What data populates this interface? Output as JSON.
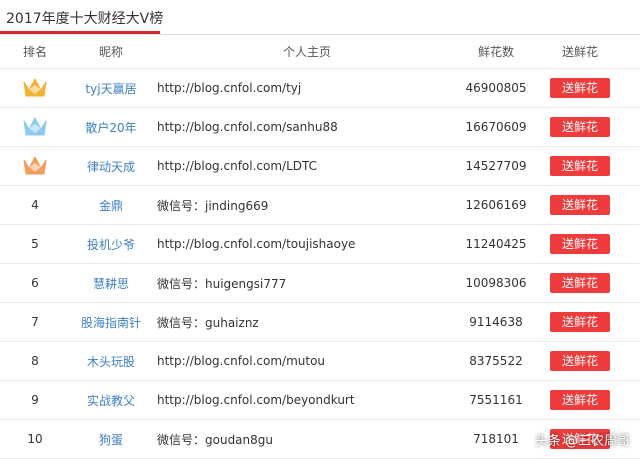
{
  "title": "2017年度十大财经大V榜",
  "colors": {
    "accent_red": "#d6292b",
    "button_red": "#ee3b3b",
    "link_blue": "#3d7fc4",
    "crown_gold": "#f2b233",
    "crown_blue": "#8ec9ee",
    "crown_orange": "#f29d5c"
  },
  "headers": {
    "rank": "排名",
    "nick": "昵称",
    "home": "个人主页",
    "count": "鲜花数",
    "send": "送鲜花"
  },
  "rows": [
    {
      "rank": "",
      "icon": "gold-crown-icon",
      "nick": "tyj天赢居",
      "home": "http://blog.cnfol.com/tyj",
      "count": "46900805",
      "send": "送鲜花"
    },
    {
      "rank": "",
      "icon": "silver-crown-icon",
      "nick": "散户20年",
      "home": "http://blog.cnfol.com/sanhu88",
      "count": "16670609",
      "send": "送鲜花"
    },
    {
      "rank": "",
      "icon": "bronze-crown-icon",
      "nick": "律动天成",
      "home": "http://blog.cnfol.com/LDTC",
      "count": "14527709",
      "send": "送鲜花"
    },
    {
      "rank": "4",
      "icon": "",
      "nick": "金鼎",
      "home": "微信号：jinding669",
      "count": "12606169",
      "send": "送鲜花"
    },
    {
      "rank": "5",
      "icon": "",
      "nick": "投机少爷",
      "home": "http://blog.cnfol.com/toujishaoye",
      "count": "11240425",
      "send": "送鲜花"
    },
    {
      "rank": "6",
      "icon": "",
      "nick": "慧耕思",
      "home": "微信号：huigengsi777",
      "count": "10098306",
      "send": "送鲜花"
    },
    {
      "rank": "7",
      "icon": "",
      "nick": "股海指南针",
      "home": "微信号：guhaiznz",
      "count": "9114638",
      "send": "送鲜花"
    },
    {
      "rank": "8",
      "icon": "",
      "nick": "木头玩股",
      "home": "http://blog.cnfol.com/mutou",
      "count": "8375522",
      "send": "送鲜花"
    },
    {
      "rank": "9",
      "icon": "",
      "nick": "实战教父",
      "home": "http://blog.cnfol.com/beyondkurt",
      "count": "7551161",
      "send": "送鲜花"
    },
    {
      "rank": "10",
      "icon": "",
      "nick": "狗蛋",
      "home": "微信号：goudan8gu",
      "count": "718101",
      "send": "送鲜花"
    }
  ],
  "watermark": "头条 @三农周哥"
}
